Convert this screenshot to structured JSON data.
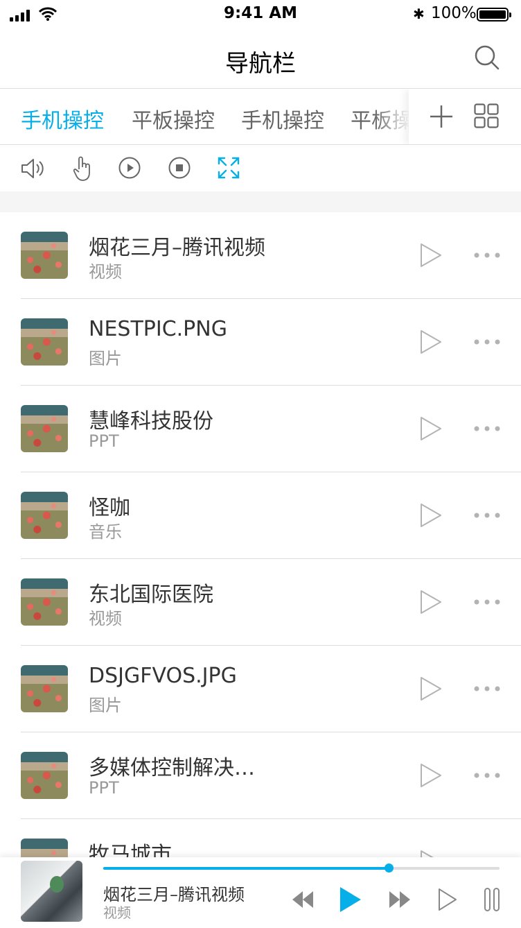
{
  "status_bar": {
    "time": "9:41 AM",
    "battery": "100%"
  },
  "nav": {
    "title": "导航栏"
  },
  "tabs": [
    {
      "label": "手机操控",
      "active": true
    },
    {
      "label": "平板操控",
      "active": false
    },
    {
      "label": "手机操控",
      "active": false
    },
    {
      "label": "平板操控",
      "active": false
    }
  ],
  "controls": [
    "volume-icon",
    "touch-icon",
    "play-icon",
    "stop-icon",
    "fullscreen-icon"
  ],
  "list": [
    {
      "name": "烟花三月–腾讯视频",
      "type": "视频"
    },
    {
      "name": "NESTPIC.PNG",
      "type": "图片"
    },
    {
      "name": "慧峰科技股份",
      "type": "PPT"
    },
    {
      "name": "怪咖",
      "type": "音乐"
    },
    {
      "name": "东北国际医院",
      "type": "视频"
    },
    {
      "name": "DSJGFVOS.JPG",
      "type": "图片"
    },
    {
      "name": "多媒体控制解决…",
      "type": "PPT"
    },
    {
      "name": "牧马城市",
      "type": ""
    }
  ],
  "player": {
    "title": "烟花三月–腾讯视频",
    "type": "视频",
    "progress": 0.72
  },
  "colors": {
    "accent": "#06afe8",
    "divider": "#dddddd",
    "section_bg": "#f5f5f5",
    "icon_gray": "#b3b3b3",
    "control_gray": "#888888",
    "text_primary": "#333333",
    "text_secondary": "#999999",
    "tab_text": "#666666"
  }
}
